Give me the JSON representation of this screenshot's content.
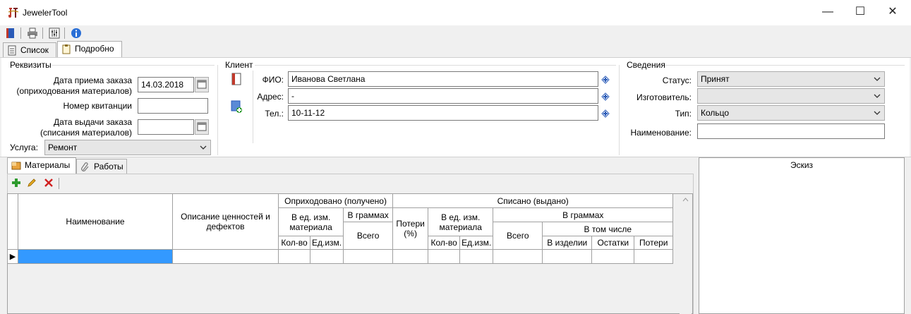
{
  "window": {
    "title": "JewelerTool",
    "minimize": "—",
    "maximize": "☐",
    "close": "✕"
  },
  "toolbar": {
    "icons": [
      "book-icon",
      "printer-icon",
      "settings-sliders-icon",
      "info-icon"
    ]
  },
  "tabs": [
    {
      "label": "Список",
      "active": false
    },
    {
      "label": "Подробно",
      "active": true
    }
  ],
  "requisites": {
    "group_title": "Реквизиты",
    "order_date_label_1": "Дата приема заказа",
    "order_date_label_2": "(оприходования материалов)",
    "order_date_value": "14.03.2018",
    "receipt_label": "Номер квитанции",
    "receipt_value": "",
    "issue_date_label_1": "Дата выдачи заказа",
    "issue_date_label_2": "(списания материалов)",
    "issue_date_value": "",
    "service_label": "Услуга:",
    "service_value": "Ремонт"
  },
  "client": {
    "group_title": "Клиент",
    "fio_label": "ФИО:",
    "fio_value": "Иванова Светлана",
    "address_label": "Адрес:",
    "address_value": "-",
    "phone_label": "Тел.:",
    "phone_value": "10-11-12"
  },
  "info": {
    "group_title": "Сведения",
    "status_label": "Статус:",
    "status_value": "Принят",
    "maker_label": "Изготовитель:",
    "maker_value": "",
    "type_label": "Тип:",
    "type_value": "Кольцо",
    "name_label": "Наименование:",
    "name_value": ""
  },
  "subtabs": [
    {
      "label": "Материалы",
      "active": true
    },
    {
      "label": "Работы",
      "active": false
    }
  ],
  "grid": {
    "col_name": "Наименование",
    "col_desc": "Описание ценностей и дефектов",
    "received": "Оприходовано (получено)",
    "received_units": "В ед. изм. материала",
    "received_grams": "В граммах",
    "qty": "Кол-во",
    "unit": "Ед.изм.",
    "total": "Всего",
    "written_off": "Списано (выдано)",
    "losses_pct": "Потери (%)",
    "wo_units": "В ед. изм. материала",
    "wo_grams": "В граммах",
    "incl": "В том числе",
    "in_item": "В изделии",
    "remains": "Остатки",
    "losses": "Потери",
    "row_marker": "▶"
  },
  "sketch": {
    "title": "Эскиз"
  }
}
